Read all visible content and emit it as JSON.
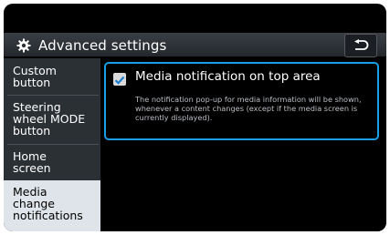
{
  "header": {
    "title": "Advanced settings"
  },
  "sidebar": {
    "items": [
      {
        "label_lines": [
          "Custom",
          "button"
        ]
      },
      {
        "label_lines": [
          "Steering",
          "wheel MODE",
          "button"
        ]
      },
      {
        "label_lines": [
          "Home",
          "screen"
        ]
      },
      {
        "label_lines": [
          "Media",
          "change",
          "notifications"
        ]
      }
    ]
  },
  "option": {
    "title": "Media notification on top area",
    "checked": true,
    "description": "The notification pop-up for media information will be shown, whenever a content changes (except if the media screen is currently displayed)."
  },
  "colors": {
    "highlight": "#1a9ee6",
    "active_item_bg": "#dfe4ea",
    "sidebar_bg": "#2b3035"
  }
}
